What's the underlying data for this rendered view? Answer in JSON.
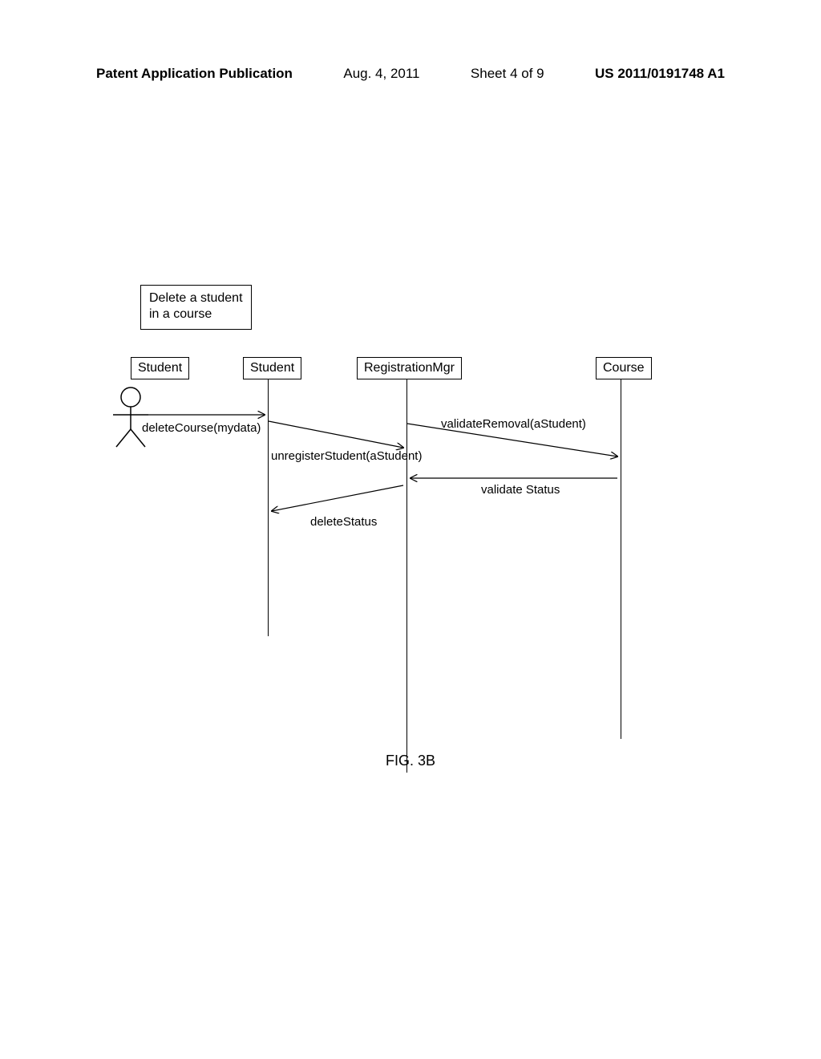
{
  "header": {
    "pub_label": "Patent Application Publication",
    "date": "Aug. 4, 2011",
    "sheet": "Sheet 4 of 9",
    "pubnum": "US 2011/0191748 A1"
  },
  "diagram": {
    "title_line1": "Delete a student",
    "title_line2": "in a course",
    "lifelines": {
      "actor": "Student",
      "student": "Student",
      "regmgr": "RegistrationMgr",
      "course": "Course"
    },
    "messages": {
      "deleteCourse": "deleteCourse(mydata)",
      "unregisterStudent": "unregisterStudent(aStudent)",
      "validateRemoval": "validateRemoval(aStudent)",
      "validateStatus": "validate Status",
      "deleteStatus": "deleteStatus"
    }
  },
  "figure_caption": "FIG. 3B"
}
